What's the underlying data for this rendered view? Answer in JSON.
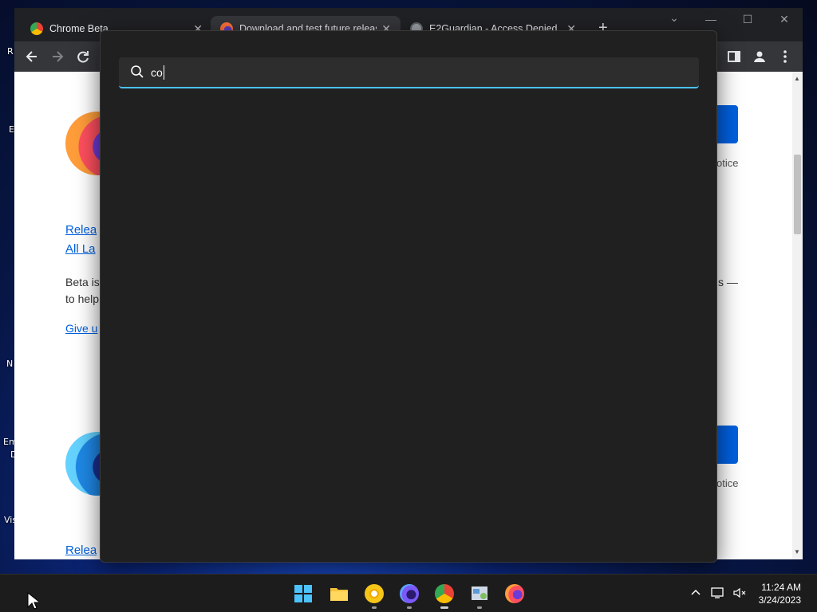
{
  "desktop": {
    "icon_labels": [
      "R",
      "E",
      "N",
      "Em",
      "D",
      "Vis"
    ]
  },
  "browser": {
    "tabs": [
      {
        "title": "Chrome Beta",
        "favicon": "chrome-beta-icon",
        "active": false
      },
      {
        "title": "Download and test future releas",
        "favicon": "firefox-beta-icon",
        "active": true
      },
      {
        "title": "E2Guardian - Access Denied",
        "favicon": "globe-icon",
        "active": false
      }
    ],
    "new_tab_label": "+",
    "close_label": "✕",
    "window_controls": {
      "dropdown": "⌄",
      "minimize": "—",
      "maximize": "☐",
      "close": "✕"
    }
  },
  "page": {
    "link_release_top": "Relea",
    "link_all_languages": "All La",
    "text_beta_line1": "Beta is",
    "text_beta_line2": "to help",
    "link_give": "Give u",
    "text_dash": "s —",
    "notice_top": "otice",
    "notice_bottom": "otice",
    "link_release_bottom": "Relea"
  },
  "search_overlay": {
    "query": "co",
    "placeholder": "",
    "accent_color": "#4cc2ff"
  },
  "taskbar": {
    "pinned": [
      "start-button",
      "file-explorer-icon",
      "chrome-canary-icon",
      "firefox-nightly-icon",
      "chrome-beta-taskbar-icon",
      "control-panel-icon",
      "firefox-icon"
    ],
    "time": "11:24 AM",
    "date": "3/24/2023"
  }
}
